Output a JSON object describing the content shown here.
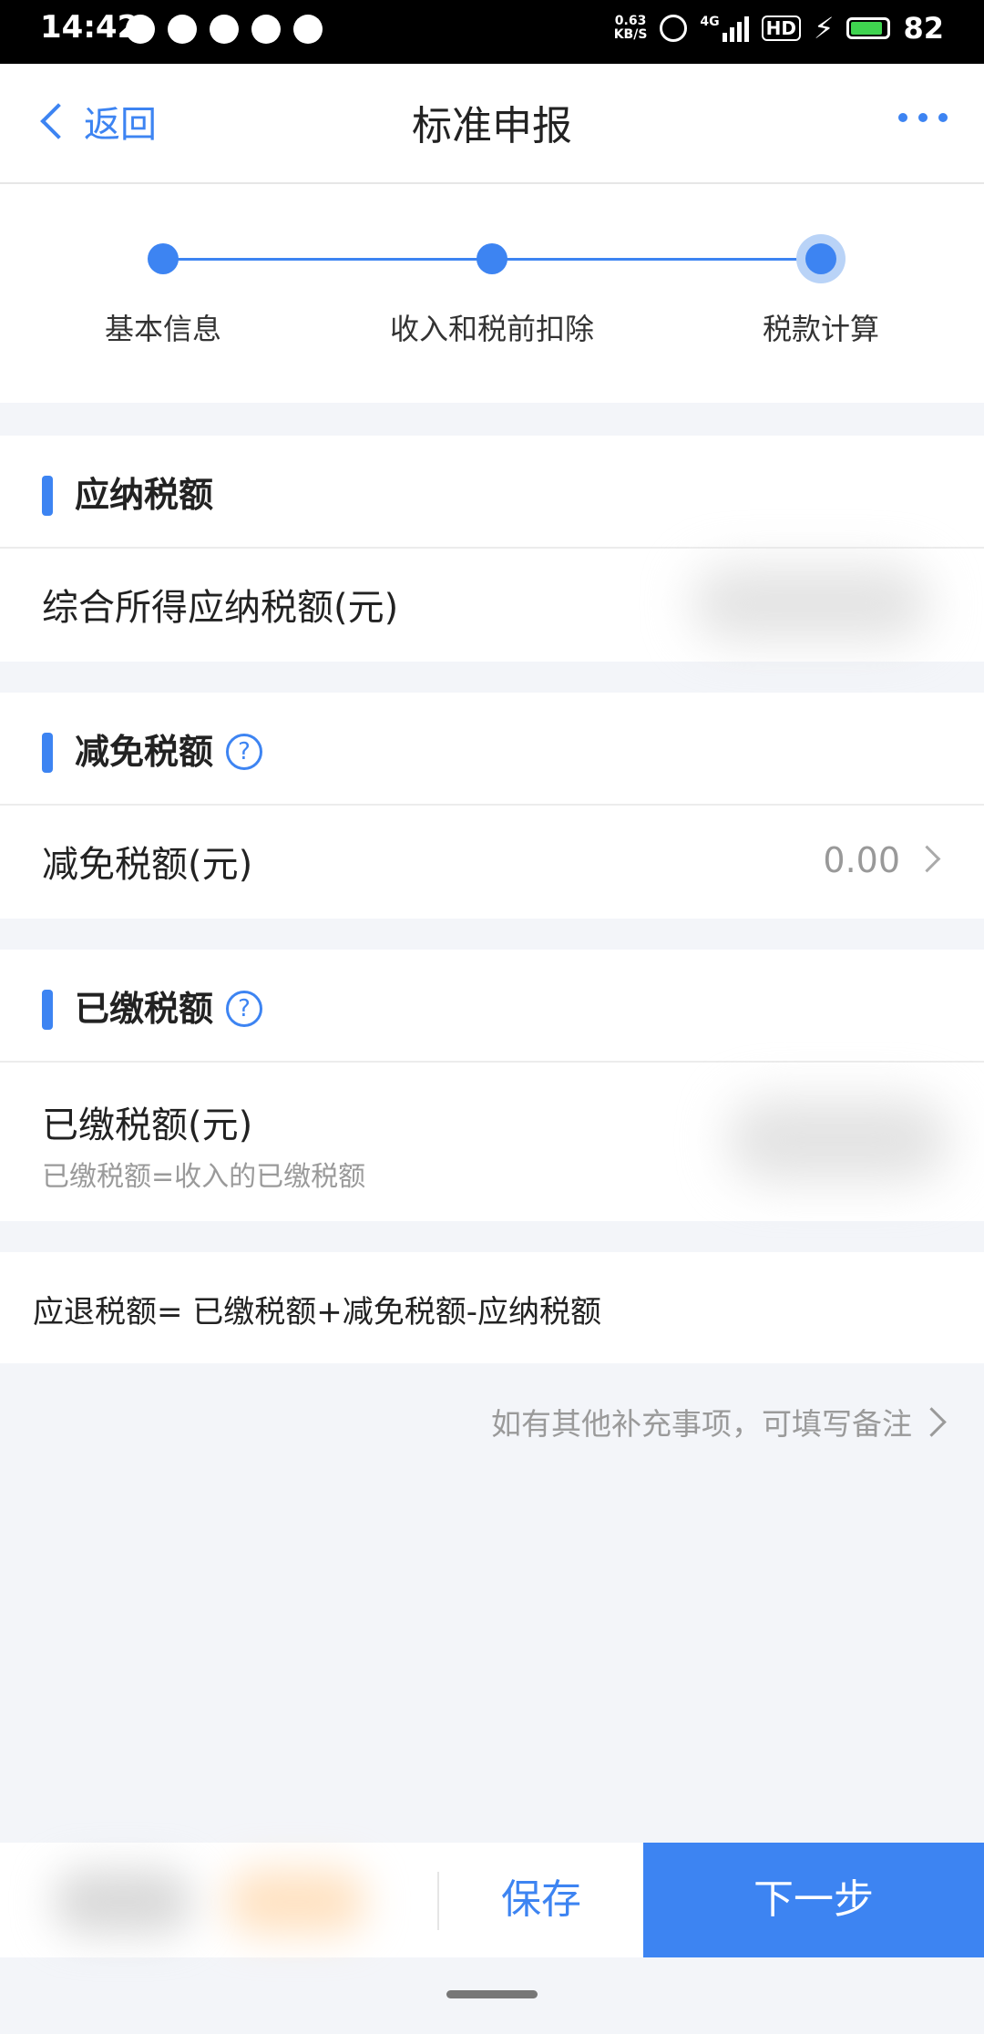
{
  "status_bar": {
    "time": "14:42",
    "speed_value": "0.63",
    "speed_unit": "KB/S",
    "network": "4G",
    "hd": "HD",
    "battery": "82"
  },
  "nav": {
    "back_label": "返回",
    "title": "标准申报"
  },
  "steps": [
    "基本信息",
    "收入和税前扣除",
    "税款计算"
  ],
  "sections": {
    "payable": {
      "title": "应纳税额",
      "row_label": "综合所得应纳税额(元)"
    },
    "relief": {
      "title": "减免税额",
      "row_label": "减免税额(元)",
      "row_value": "0.00"
    },
    "paid": {
      "title": "已缴税额",
      "row_label": "已缴税额(元)",
      "row_sub": "已缴税额=收入的已缴税额"
    }
  },
  "formula": "应退税额= 已缴税额+减免税额-应纳税额",
  "note": "如有其他补充事项，可填写备注",
  "bottom": {
    "save_label": "保存",
    "next_label": "下一步"
  },
  "colors": {
    "accent": "#3d84f2",
    "background": "#f3f5f9"
  }
}
